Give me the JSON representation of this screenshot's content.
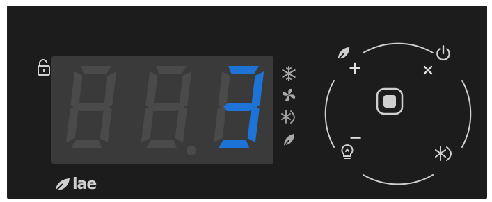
{
  "brand": {
    "logo_text": "lae"
  },
  "display": {
    "digits": [
      {
        "value": "",
        "active_color": ""
      },
      {
        "value": "",
        "active_color": ""
      },
      {
        "value": "3",
        "active_color": "#1e73d6"
      }
    ],
    "decimal_point_lit": false,
    "segment_off_color": "#4a4a4a",
    "segment_on_color": "#1e73d6",
    "lcd_background": "#3a3a3a"
  },
  "status_icons": [
    "snowflake-icon",
    "fan-icon",
    "defrost-icon",
    "leaf-icon"
  ],
  "controls": {
    "up_label": "+",
    "down_label": "−",
    "set_label": "",
    "buttons": [
      "eco-button",
      "power-button",
      "light-button",
      "defrost-button",
      "center-set-button"
    ]
  },
  "colors": {
    "panel": "#1c1c1c",
    "icon": "#cfcfcf",
    "icon_dim": "#a8a8a8",
    "accent": "#1e73d6"
  }
}
